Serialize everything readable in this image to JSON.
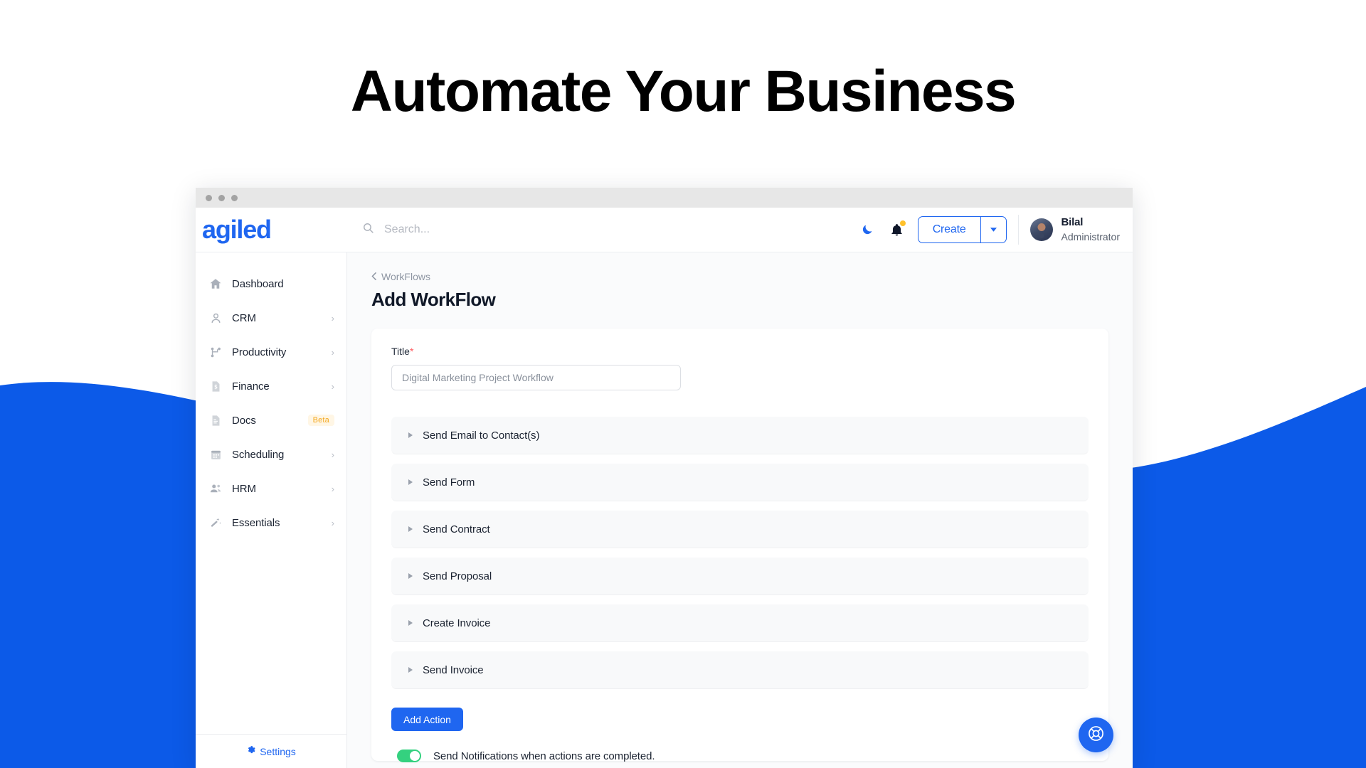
{
  "hero": {
    "headline": "Automate Your Business"
  },
  "colors": {
    "brand_blue": "#1f66f0",
    "wave_blue": "#0c5ae8",
    "toggle_green": "#34d17f",
    "beta_amber": "#f4a922",
    "required_red": "#ff5a5f"
  },
  "window": {
    "dots": [
      "close",
      "minimize",
      "maximize"
    ]
  },
  "header": {
    "logo": "agiled",
    "search": {
      "value": "",
      "placeholder": "Search..."
    },
    "dark_mode_icon": "moon-icon",
    "notifications_icon": "bell-icon",
    "notifications_has_unread": true,
    "create_label": "Create",
    "create_caret_icon": "chevron-down-icon",
    "user": {
      "name": "Bilal",
      "role": "Administrator"
    }
  },
  "sidebar": {
    "items": [
      {
        "label": "Dashboard",
        "icon": "home-icon",
        "caret": false,
        "badge": null,
        "active": false
      },
      {
        "label": "CRM",
        "icon": "user-icon",
        "caret": true,
        "badge": null,
        "active": false
      },
      {
        "label": "Productivity",
        "icon": "sitemap-icon",
        "caret": true,
        "badge": null,
        "active": false
      },
      {
        "label": "Finance",
        "icon": "invoice-icon",
        "caret": true,
        "badge": null,
        "active": false
      },
      {
        "label": "Docs",
        "icon": "document-icon",
        "caret": false,
        "badge": "Beta",
        "active": false
      },
      {
        "label": "Scheduling",
        "icon": "calendar-icon",
        "caret": true,
        "badge": null,
        "active": false
      },
      {
        "label": "HRM",
        "icon": "users-icon",
        "caret": true,
        "badge": null,
        "active": false
      },
      {
        "label": "Essentials",
        "icon": "magic-wand-icon",
        "caret": true,
        "badge": null,
        "active": false
      }
    ],
    "settings_label": "Settings",
    "settings_icon": "gear-icon"
  },
  "main": {
    "breadcrumb": {
      "back_icon": "chevron-left-icon",
      "label": "WorkFlows"
    },
    "page_title": "Add WorkFlow",
    "form": {
      "title_label": "Title",
      "title_required_mark": "*",
      "title_value": "",
      "title_placeholder": "Digital Marketing Project Workflow"
    },
    "actions": [
      {
        "label": "Send Email to Contact(s)",
        "expanded": false
      },
      {
        "label": "Send Form",
        "expanded": false
      },
      {
        "label": "Send Contract",
        "expanded": false
      },
      {
        "label": "Send Proposal",
        "expanded": false
      },
      {
        "label": "Create Invoice",
        "expanded": false
      },
      {
        "label": "Send Invoice",
        "expanded": false
      }
    ],
    "add_action_label": "Add Action",
    "notifications": {
      "enabled": true,
      "label": "Send Notifications when actions are completed."
    },
    "help_fab_icon": "life-ring-icon"
  }
}
